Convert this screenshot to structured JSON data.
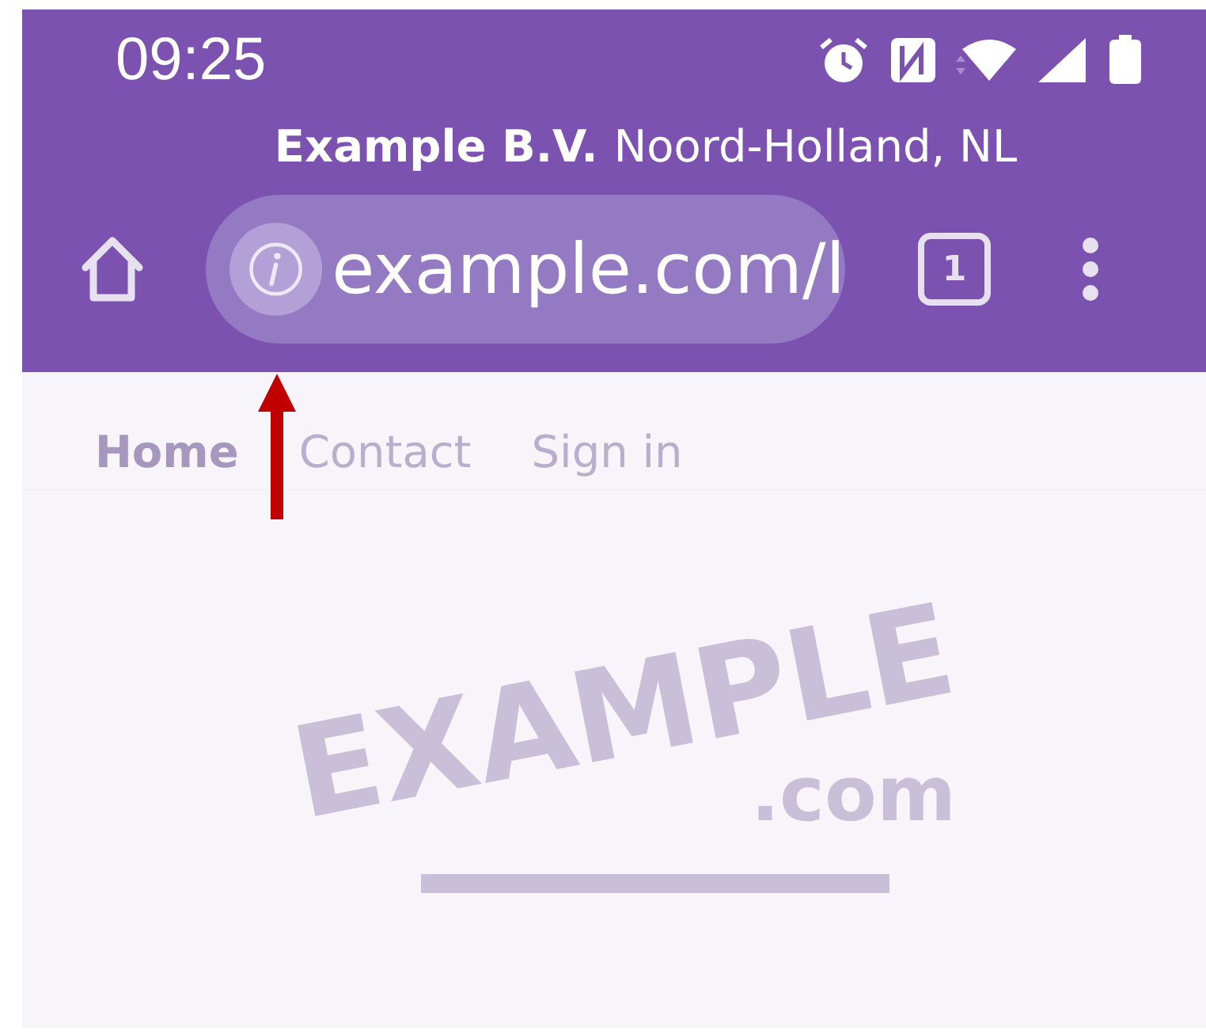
{
  "status_bar": {
    "time": "09:25"
  },
  "site_info": {
    "organization": "Example B.V.",
    "location": "Noord-Holland, NL"
  },
  "address_bar": {
    "url": "example.com/l"
  },
  "tab_count": "1",
  "nav": [
    {
      "label": "Home",
      "selected": true
    },
    {
      "label": "Contact",
      "selected": false
    },
    {
      "label": "Sign in",
      "selected": false
    }
  ],
  "logo": {
    "name": "EXAMPLE",
    "suffix": ".com"
  }
}
